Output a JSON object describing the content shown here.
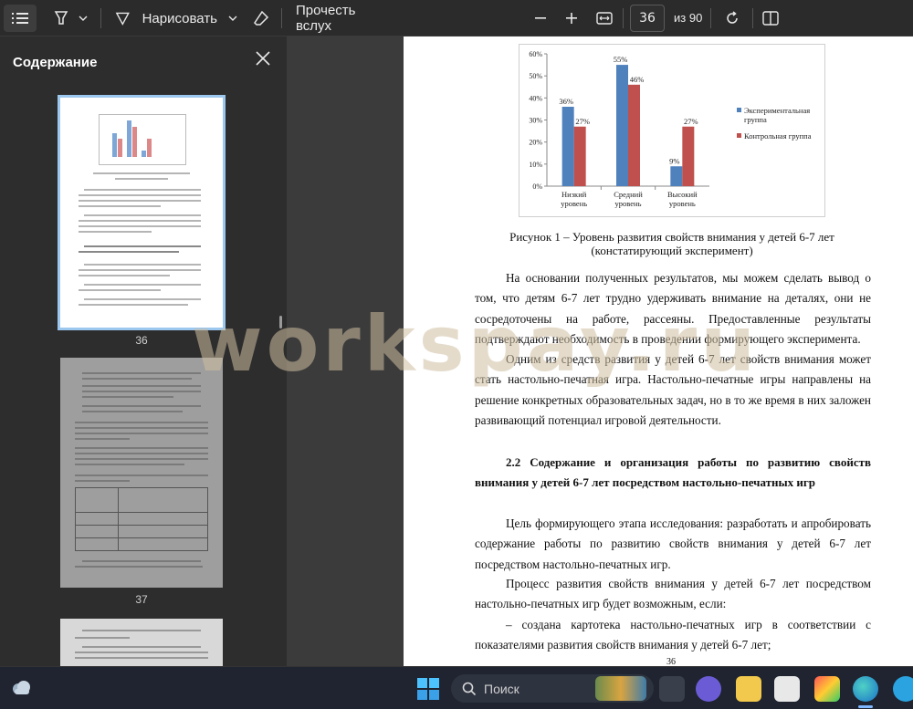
{
  "toolbar": {
    "draw_label": "Нарисовать",
    "read_aloud_label": "Прочесть вслух",
    "page_current": "36",
    "page_total": "из 90"
  },
  "sidebar": {
    "title": "Содержание",
    "thumbnails": [
      {
        "label": "36"
      },
      {
        "label": "37"
      }
    ]
  },
  "document": {
    "caption_line1": "Рисунок 1 – Уровень развития свойств внимания у детей 6-7 лет",
    "caption_line2": "(констатирующий эксперимент)",
    "para1": "На основании полученных результатов, мы можем сделать вывод о том, что детям 6-7 лет трудно удерживать внимание на деталях, они не сосредоточены на работе, рассеяны. Предоставленные результаты подтверждают необходимость в проведении формирующего эксперимента.",
    "para2": "Одним из средств развития у детей 6-7 лет свойств внимания может стать настольно-печатная игра. Настольно-печатные игры направлены на решение конкретных образовательных задач, но в то же время в них заложен развивающий потенциал игровой деятельности.",
    "heading": "2.2 Содержание и организация работы по развитию свойств внимания у детей 6-7 лет посредством настольно-печатных игр",
    "para3": "Цель формирующего этапа исследования: разработать и апробировать содержание работы по развитию свойств внимания у детей 6-7 лет посредством настольно-печатных игр.",
    "para4": "Процесс развития свойств внимания у детей 6-7 лет посредством настольно-печатных игр будет возможным, если:",
    "para5": "– создана картотека настольно-печатных игр в соответствии с показателями развития свойств внимания у детей 6-7 лет;",
    "page_number": "36"
  },
  "watermark": "workspay.ru",
  "taskbar": {
    "search_label": "Поиск"
  },
  "chart_data": {
    "type": "bar",
    "categories": [
      "Низкий уровень",
      "Средний уровень",
      "Высокий уровень"
    ],
    "category_lines": [
      [
        "Низкий",
        "уровень"
      ],
      [
        "Средний",
        "уровень"
      ],
      [
        "Высокий",
        "уровень"
      ]
    ],
    "series": [
      {
        "name": "Экспериментальная группа",
        "name_lines": [
          "Экспериментальная",
          "группа"
        ],
        "values": [
          36,
          55,
          9
        ],
        "labels": [
          "36%",
          "55%",
          "9%"
        ],
        "color": "#4f81bd"
      },
      {
        "name": "Контрольная группа",
        "name_lines": [
          "Контрольная группа"
        ],
        "values": [
          27,
          46,
          27
        ],
        "labels": [
          "27%",
          "46%",
          "27%"
        ],
        "color": "#c0504d"
      }
    ],
    "yticks": [
      "0%",
      "10%",
      "20%",
      "30%",
      "40%",
      "50%",
      "60%"
    ],
    "ylim": [
      0,
      60
    ],
    "grid": false,
    "legend": "right"
  }
}
